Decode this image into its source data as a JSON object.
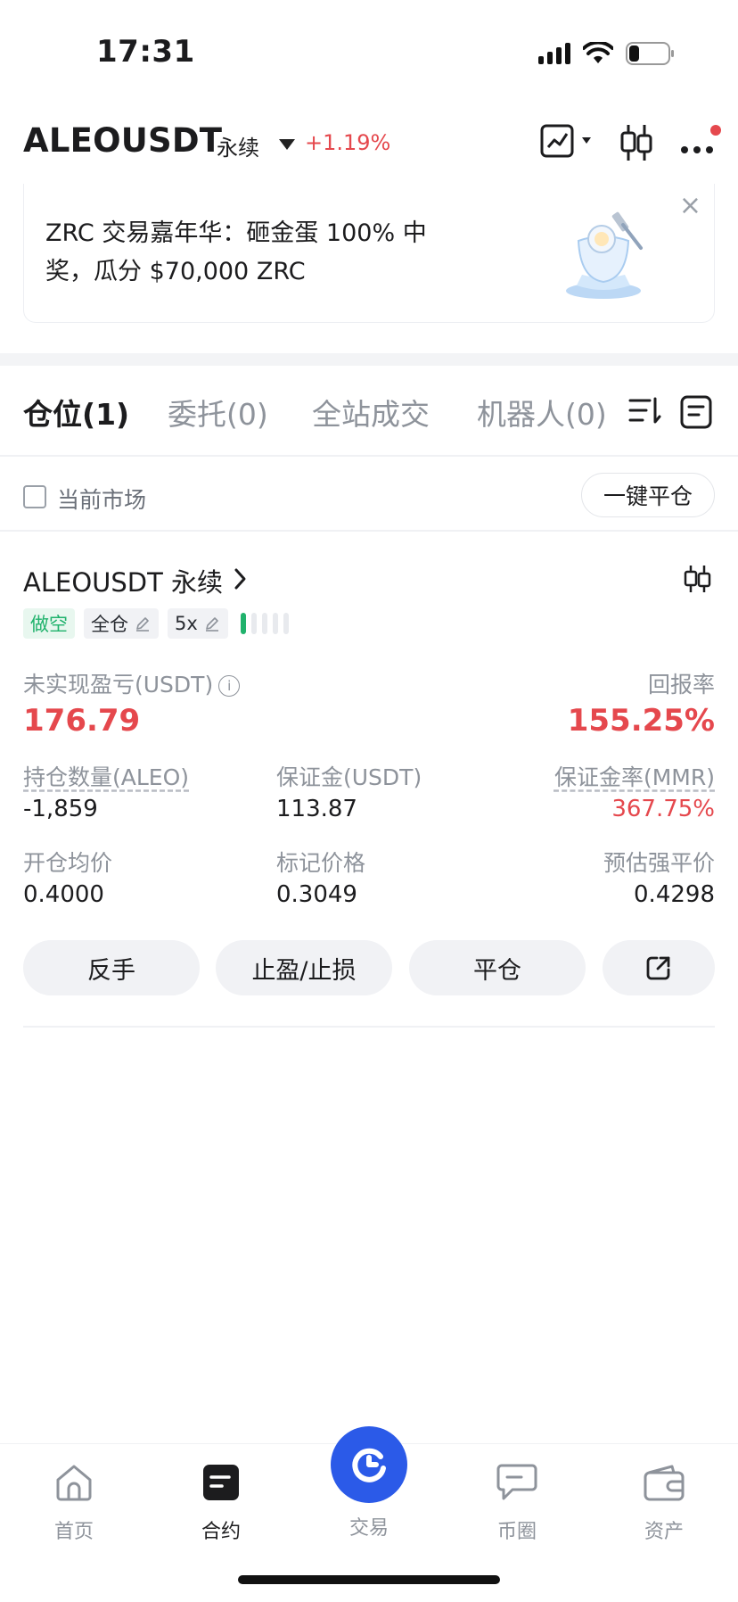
{
  "status_bar": {
    "time": "17:31"
  },
  "header": {
    "pair": "ALEOUSDT",
    "contract_type": "永续",
    "change": "+1.19%"
  },
  "banner": {
    "text": "ZRC 交易嘉年华：砸金蛋 100% 中奖，瓜分 $70,000 ZRC",
    "close": "×"
  },
  "tabs": [
    {
      "label": "仓位(1)"
    },
    {
      "label": "委托(0)"
    },
    {
      "label": "全站成交"
    },
    {
      "label": "机器人(0)"
    }
  ],
  "filter": {
    "checkbox_label": "当前市场",
    "close_all": "一键平仓"
  },
  "position": {
    "title": "ALEOUSDT 永续",
    "side_tag": "做空",
    "margin_mode": "全仓",
    "leverage": "5x",
    "risk_level": 1,
    "pnl_label": "未实现盈亏(USDT)",
    "pnl_value": "176.79",
    "roe_label": "回报率",
    "roe_value": "155.25%",
    "stats_row1": [
      {
        "label": "持仓数量(ALEO)",
        "value": "-1,859"
      },
      {
        "label": "保证金(USDT)",
        "value": "113.87"
      },
      {
        "label": "保证金率(MMR)",
        "value": "367.75%"
      }
    ],
    "stats_row2": [
      {
        "label": "开仓均价",
        "value": "0.4000"
      },
      {
        "label": "标记价格",
        "value": "0.3049"
      },
      {
        "label": "预估强平价",
        "value": "0.4298"
      }
    ],
    "actions": [
      {
        "label": "反手"
      },
      {
        "label": "止盈/止损"
      },
      {
        "label": "平仓"
      }
    ]
  },
  "bottom_nav": [
    {
      "label": "首页",
      "icon": "home-icon"
    },
    {
      "label": "合约",
      "icon": "contract-icon"
    },
    {
      "label": "交易",
      "icon": "trade-icon"
    },
    {
      "label": "币圈",
      "icon": "chat-icon"
    },
    {
      "label": "资产",
      "icon": "wallet-icon"
    }
  ],
  "colors": {
    "up_red": "#e5484d",
    "short_green": "#20b26c",
    "brand_blue": "#2b5ae8"
  }
}
